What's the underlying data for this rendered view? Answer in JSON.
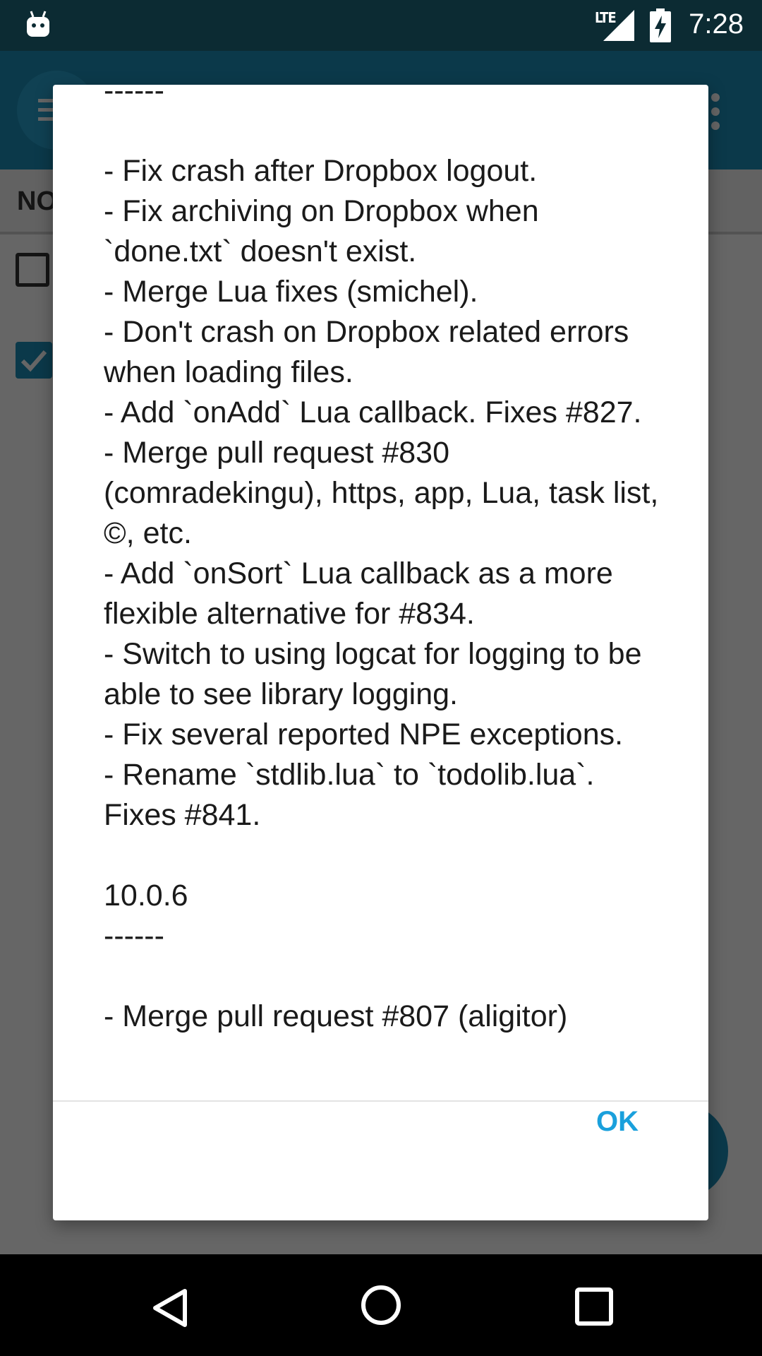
{
  "status_bar": {
    "network_label": "LTE",
    "time": "7:28"
  },
  "background_app": {
    "tab_label": "NO"
  },
  "dialog": {
    "changelog_text": "------\n\n- Fix crash after Dropbox logout.\n- Fix archiving on Dropbox when `done.txt` doesn't exist.\n- Merge Lua fixes (smichel).\n- Don't crash on Dropbox related errors when loading files.\n- Add `onAdd` Lua callback. Fixes #827.\n- Merge pull request #830 (comradekingu), https, app, Lua, task list, ©, etc.\n- Add `onSort` Lua callback as a more flexible alternative for #834.\n- Switch to using logcat for logging to be able to see library logging.\n- Fix several reported NPE exceptions.\n- Rename `stdlib.lua` to `todolib.lua`. Fixes #841.\n\n10.0.6\n------\n\n- Merge pull request #807 (aligitor)",
    "ok_label": "OK"
  },
  "colors": {
    "status_bar": "#0c2b33",
    "toolbar": "#1d8fb8",
    "accent": "#1aa0dc",
    "nav_bar": "#000000"
  },
  "icons": [
    "android-icon",
    "signal-icon",
    "battery-charging-icon",
    "menu-icon",
    "overflow-icon",
    "back-icon",
    "home-icon",
    "recents-icon"
  ]
}
